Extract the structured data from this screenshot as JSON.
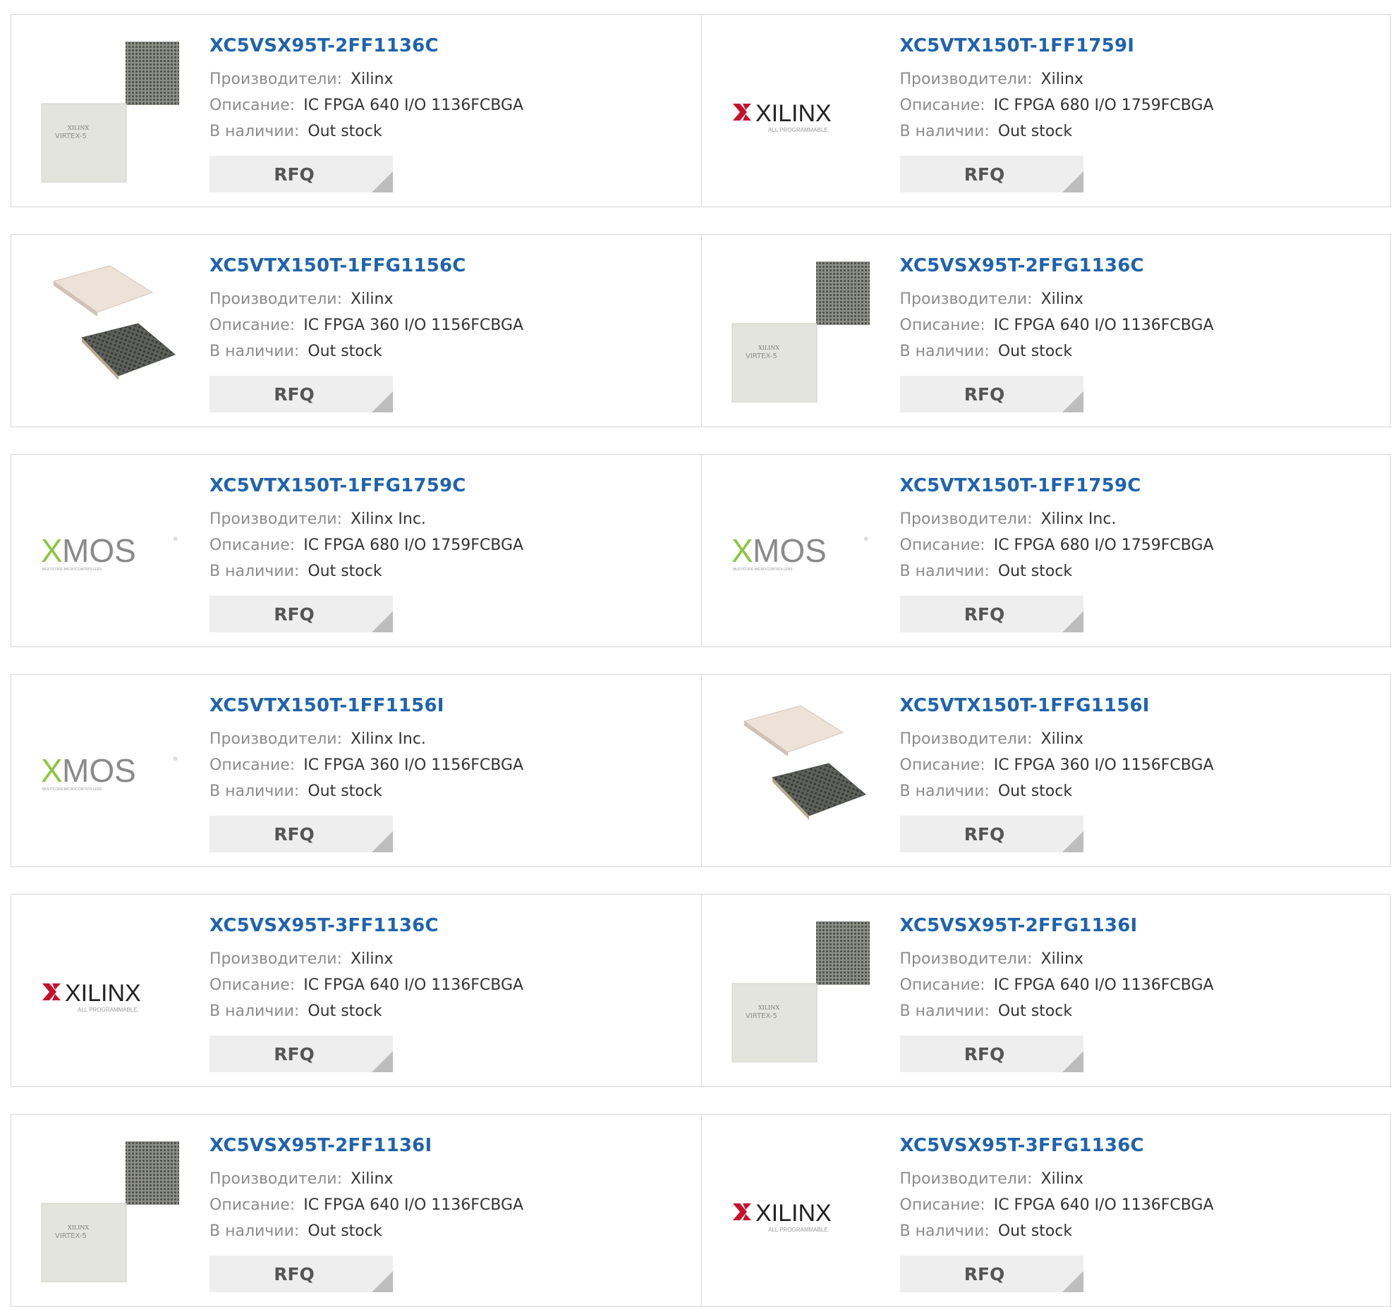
{
  "labels": {
    "manufacturer": "Производители:",
    "description": "Описание:",
    "availability": "В наличии:",
    "rfq": "RFQ"
  },
  "logos": {
    "xilinx_name": "XILINX",
    "xilinx_tagline": "ALL PROGRAMMABLE.",
    "xmos_x": "X",
    "xmos_name": "MOS",
    "xmos_tagline": "MULTICORE MICROCONTROLLERS",
    "virtex_brand": "XILINX",
    "virtex_name": "VIRTEX-5"
  },
  "colors": {
    "link": "#1f63ad",
    "xilinx_red": "#c8102e",
    "xmos_green": "#8cc63f"
  },
  "products": [
    {
      "pn": "XC5VSX95T-2FF1136C",
      "mfr": "Xilinx",
      "desc": "IC FPGA 640 I/O 1136FCBGA",
      "stock": "Out stock",
      "image": "virtex-chip"
    },
    {
      "pn": "XC5VTX150T-1FF1759I",
      "mfr": "Xilinx",
      "desc": "IC FPGA 680 I/O 1759FCBGA",
      "stock": "Out stock",
      "image": "xilinx-logo"
    },
    {
      "pn": "XC5VTX150T-1FFG1156C",
      "mfr": "Xilinx",
      "desc": "IC FPGA 360 I/O 1156FCBGA",
      "stock": "Out stock",
      "image": "chip-stack"
    },
    {
      "pn": "XC5VSX95T-2FFG1136C",
      "mfr": "Xilinx",
      "desc": "IC FPGA 640 I/O 1136FCBGA",
      "stock": "Out stock",
      "image": "virtex-chip"
    },
    {
      "pn": "XC5VTX150T-1FFG1759C",
      "mfr": "Xilinx Inc.",
      "desc": "IC FPGA 680 I/O 1759FCBGA",
      "stock": "Out stock",
      "image": "xmos-logo"
    },
    {
      "pn": "XC5VTX150T-1FF1759C",
      "mfr": "Xilinx Inc.",
      "desc": "IC FPGA 680 I/O 1759FCBGA",
      "stock": "Out stock",
      "image": "xmos-logo"
    },
    {
      "pn": "XC5VTX150T-1FF1156I",
      "mfr": "Xilinx Inc.",
      "desc": "IC FPGA 360 I/O 1156FCBGA",
      "stock": "Out stock",
      "image": "xmos-logo"
    },
    {
      "pn": "XC5VTX150T-1FFG1156I",
      "mfr": "Xilinx",
      "desc": "IC FPGA 360 I/O 1156FCBGA",
      "stock": "Out stock",
      "image": "chip-stack"
    },
    {
      "pn": "XC5VSX95T-3FF1136C",
      "mfr": "Xilinx",
      "desc": "IC FPGA 640 I/O 1136FCBGA",
      "stock": "Out stock",
      "image": "xilinx-logo"
    },
    {
      "pn": "XC5VSX95T-2FFG1136I",
      "mfr": "Xilinx",
      "desc": "IC FPGA 640 I/O 1136FCBGA",
      "stock": "Out stock",
      "image": "virtex-chip"
    },
    {
      "pn": "XC5VSX95T-2FF1136I",
      "mfr": "Xilinx",
      "desc": "IC FPGA 640 I/O 1136FCBGA",
      "stock": "Out stock",
      "image": "virtex-chip"
    },
    {
      "pn": "XC5VSX95T-3FFG1136C",
      "mfr": "Xilinx",
      "desc": "IC FPGA 640 I/O 1136FCBGA",
      "stock": "Out stock",
      "image": "xilinx-logo"
    }
  ]
}
